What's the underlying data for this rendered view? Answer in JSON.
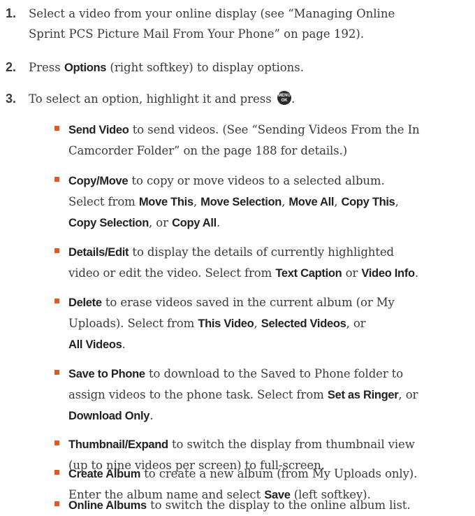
{
  "steps": [
    {
      "num": "1.",
      "lines": [
        "Select a video from your online display (see “Managing Online",
        "Sprint PCS Picture Mail From Your Phone” on page 192)."
      ]
    },
    {
      "num": "2.",
      "pre": "Press ",
      "key": "Options",
      "post": " (right softkey) to display options."
    },
    {
      "num": "3.",
      "pre": "To select an option, highlight it and press ",
      "icon_top": "MENU",
      "icon_bottom": "OK",
      "post": "."
    }
  ],
  "bullets": {
    "send": {
      "k": "Send Video",
      "t1": " to send videos. (See “Sending Videos From the In",
      "t2": "Camcorder Folder” on the page 188 for details.)"
    },
    "copy": {
      "k": "Copy/Move",
      "t1": " to copy or move videos to a selected album.",
      "t2": "Select from ",
      "o1": "Move This",
      "o2": "Move Selection",
      "o3": "Move All",
      "o4": "Copy This",
      "o5": "Copy Selection",
      "o6": "Copy All",
      "sep": ", ",
      "or": ", or ",
      "end": "."
    },
    "details": {
      "k": "Details/Edit",
      "t1": " to display the details of currently highlighted",
      "t2": "video or edit the video. Select from ",
      "o1": "Text Caption",
      "or": " or ",
      "o2": "Video Info",
      "end": "."
    },
    "delete": {
      "k": "Delete",
      "t1": " to erase videos saved in the current album (or My",
      "t2": "Uploads). Select from ",
      "o1": "This Video",
      "o2": "Selected Videos",
      "sep": ", ",
      "or": ", or",
      "o3": "All Videos",
      "end": "."
    },
    "save": {
      "k": "Save to Phone",
      "t1": " to download to the Saved to Phone folder to",
      "t2": "assign videos to the phone task. Select from ",
      "o1": "Set as Ringer",
      "or": ", or",
      "o2": "Download Only",
      "end": "."
    },
    "thumb": {
      "k": "Thumbnail/Expand",
      "t1": " to switch the display from thumbnail view",
      "t2": "(up to nine videos per screen) to full-screen."
    },
    "album": {
      "k": "Create Album",
      "t1": " to create a new album (from My Uploads only).",
      "t2": "Enter the album name and select ",
      "o1": "Save",
      "t3": " (left softkey)."
    },
    "online": {
      "k": "Online Albums",
      "t1": " to switch the display to the online album list."
    }
  },
  "colors": {
    "bullet": "#e05a26",
    "text": "#3a3a3a"
  }
}
